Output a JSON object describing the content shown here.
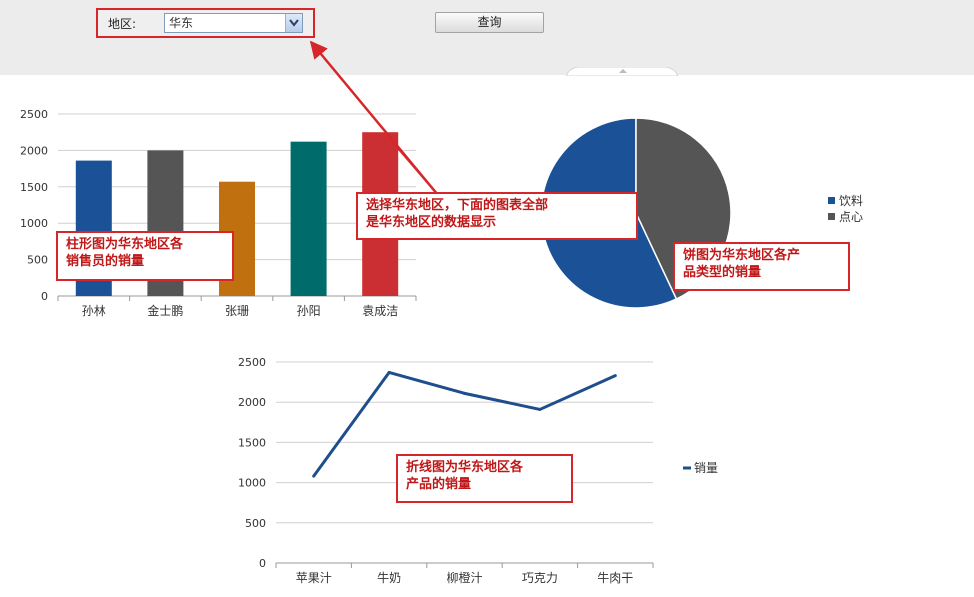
{
  "filter": {
    "region_label": "地区:",
    "region_value": "华东",
    "query_label": "查询"
  },
  "annotations": {
    "filter_note": "选择华东地区，下面的图表全部\n是华东地区的数据显示",
    "bar_note": "柱形图为华东地区各\n销售员的销量",
    "pie_note": "饼图为华东地区各产\n品类型的销量",
    "line_note": "折线图为华东地区各\n产品的销量"
  },
  "colors": {
    "annotation": "#d6262a",
    "bar_1": "#1b5196",
    "bar_2": "#555555",
    "bar_3": "#c0700e",
    "bar_4": "#006b6b",
    "bar_5": "#cc2f33",
    "line": "#1f4e8c",
    "grid": "#d0d0d0"
  },
  "chart_data": [
    {
      "type": "bar",
      "categories": [
        "孙林",
        "金士鹏",
        "张珊",
        "孙阳",
        "袁成洁"
      ],
      "values": [
        1860,
        2000,
        1570,
        2120,
        2250
      ],
      "ylim": [
        0,
        2500
      ],
      "yticks": [
        0,
        500,
        1000,
        1500,
        2000,
        2500
      ],
      "grid": true
    },
    {
      "type": "pie",
      "labels": [
        "饮料",
        "点心"
      ],
      "values": [
        57,
        43
      ],
      "legend": "right"
    },
    {
      "type": "line",
      "categories": [
        "苹果汁",
        "牛奶",
        "柳橙汁",
        "巧克力",
        "牛肉干"
      ],
      "series": [
        {
          "name": "销量",
          "values": [
            1080,
            2370,
            2110,
            1910,
            2330
          ]
        }
      ],
      "ylim": [
        0,
        2500
      ],
      "yticks": [
        0,
        500,
        1000,
        1500,
        2000,
        2500
      ],
      "grid": true,
      "legend": "right"
    }
  ]
}
